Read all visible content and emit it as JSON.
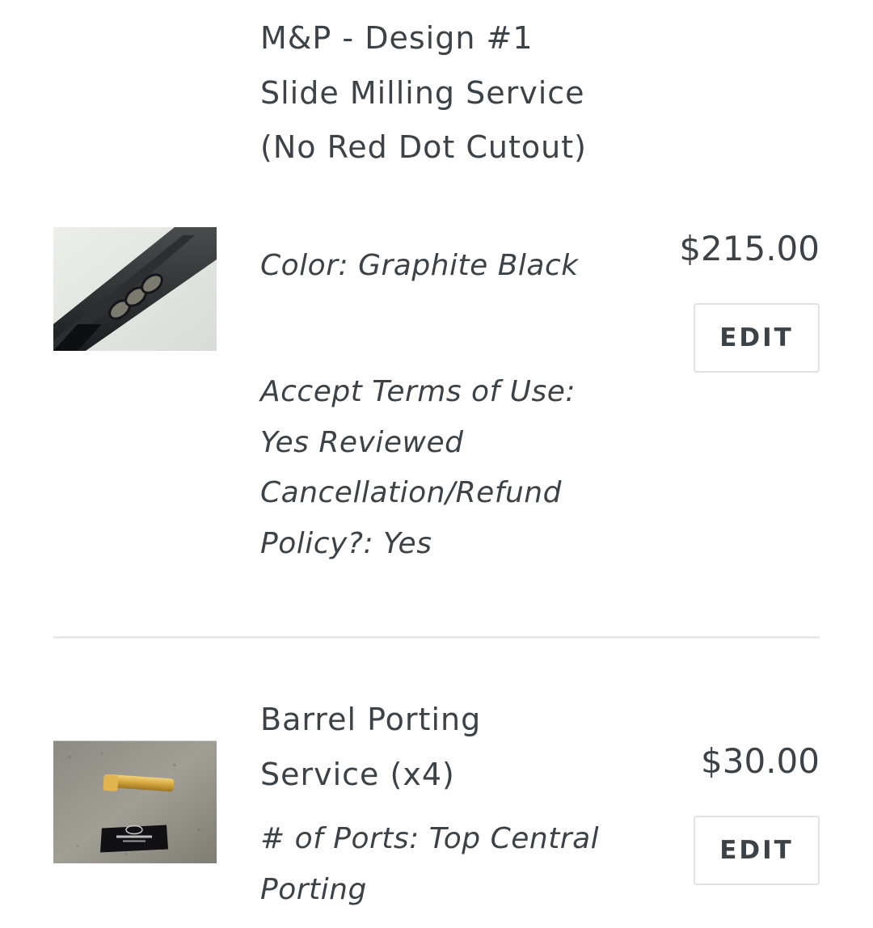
{
  "cart": {
    "items": [
      {
        "title": "M&P - Design #1 Slide Milling Service (No Red Dot Cutout)",
        "properties": [
          "Color: Graphite Black",
          "Accept Terms of Use: Yes Reviewed Cancellation/Refund Policy?: Yes"
        ],
        "price": "$215.00",
        "edit_label": "EDIT",
        "image_icon": "pistol-slide-image"
      },
      {
        "title": "Barrel Porting Service (x4)",
        "properties": [
          "# of Ports: Top Central Porting"
        ],
        "price": "$30.00",
        "edit_label": "EDIT",
        "image_icon": "gold-barrel-image"
      }
    ]
  },
  "colors": {
    "text": "#3d4246",
    "button_border": "#e2e2e2",
    "divider": "#e8e8e8"
  }
}
